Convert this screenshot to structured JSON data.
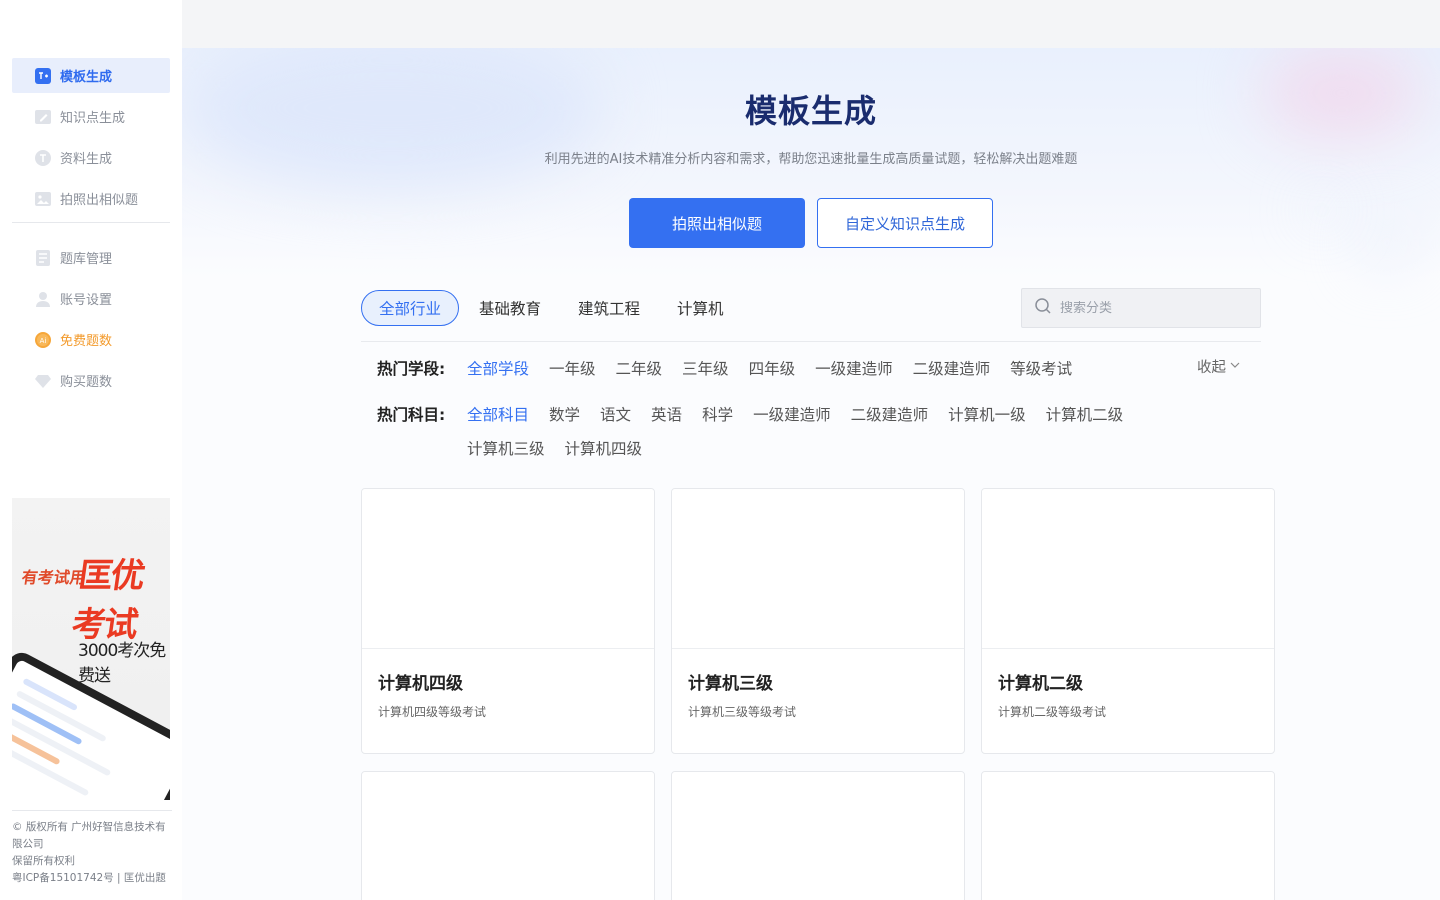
{
  "sidebar": {
    "nav": [
      {
        "label": "模板生成",
        "icon": "template-icon",
        "state": "active"
      },
      {
        "label": "知识点生成",
        "icon": "pen-icon",
        "state": ""
      },
      {
        "label": "资料生成",
        "icon": "text-doc-icon",
        "state": ""
      },
      {
        "label": "拍照出相似题",
        "icon": "image-icon",
        "state": ""
      }
    ],
    "nav2": [
      {
        "label": "题库管理",
        "icon": "question-bank-icon",
        "state": ""
      },
      {
        "label": "账号设置",
        "icon": "user-icon",
        "state": ""
      },
      {
        "label": "免费题数",
        "icon": "ai-coin-icon",
        "state": "free"
      },
      {
        "label": "购买题数",
        "icon": "diamond-icon",
        "state": ""
      }
    ],
    "promo": {
      "line1": "有考试用",
      "line2": "匡优考试",
      "line3": "3000考次免费送"
    },
    "footer": {
      "line1": "© 版权所有 广州好智信息技术有限公司",
      "line2": "保留所有权利",
      "line3": "粤ICP备15101742号 | 匡优出题"
    }
  },
  "hero": {
    "title": "模板生成",
    "subtitle": "利用先进的AI技术精准分析内容和需求，帮助您迅速批量生成高质量试题，轻松解决出题难题",
    "primary_button": "拍照出相似题",
    "secondary_button": "自定义知识点生成"
  },
  "tabs": [
    {
      "label": "全部行业",
      "active": true
    },
    {
      "label": "基础教育",
      "active": false
    },
    {
      "label": "建筑工程",
      "active": false
    },
    {
      "label": "计算机",
      "active": false
    }
  ],
  "search": {
    "placeholder": "搜索分类",
    "value": ""
  },
  "filters": {
    "stage_label": "热门学段:",
    "stage_options": [
      "全部学段",
      "一年级",
      "二年级",
      "三年级",
      "四年级",
      "一级建造师",
      "二级建造师",
      "等级考试"
    ],
    "subject_label": "热门科目:",
    "subject_options": [
      "全部科目",
      "数学",
      "语文",
      "英语",
      "科学",
      "一级建造师",
      "二级建造师",
      "计算机一级",
      "计算机二级"
    ],
    "subject_options_2": [
      "计算机三级",
      "计算机四级"
    ],
    "collapse": "收起"
  },
  "cards": [
    {
      "title": "计算机四级",
      "desc": "计算机四级等级考试"
    },
    {
      "title": "计算机三级",
      "desc": "计算机三级等级考试"
    },
    {
      "title": "计算机二级",
      "desc": "计算机二级等级考试"
    },
    {
      "title": "",
      "desc": ""
    },
    {
      "title": "",
      "desc": ""
    },
    {
      "title": "",
      "desc": ""
    }
  ],
  "colors": {
    "accent": "#3470f1",
    "title": "#1a2c6e",
    "free": "#f39a2b",
    "promo_red": "#ea3a22"
  }
}
